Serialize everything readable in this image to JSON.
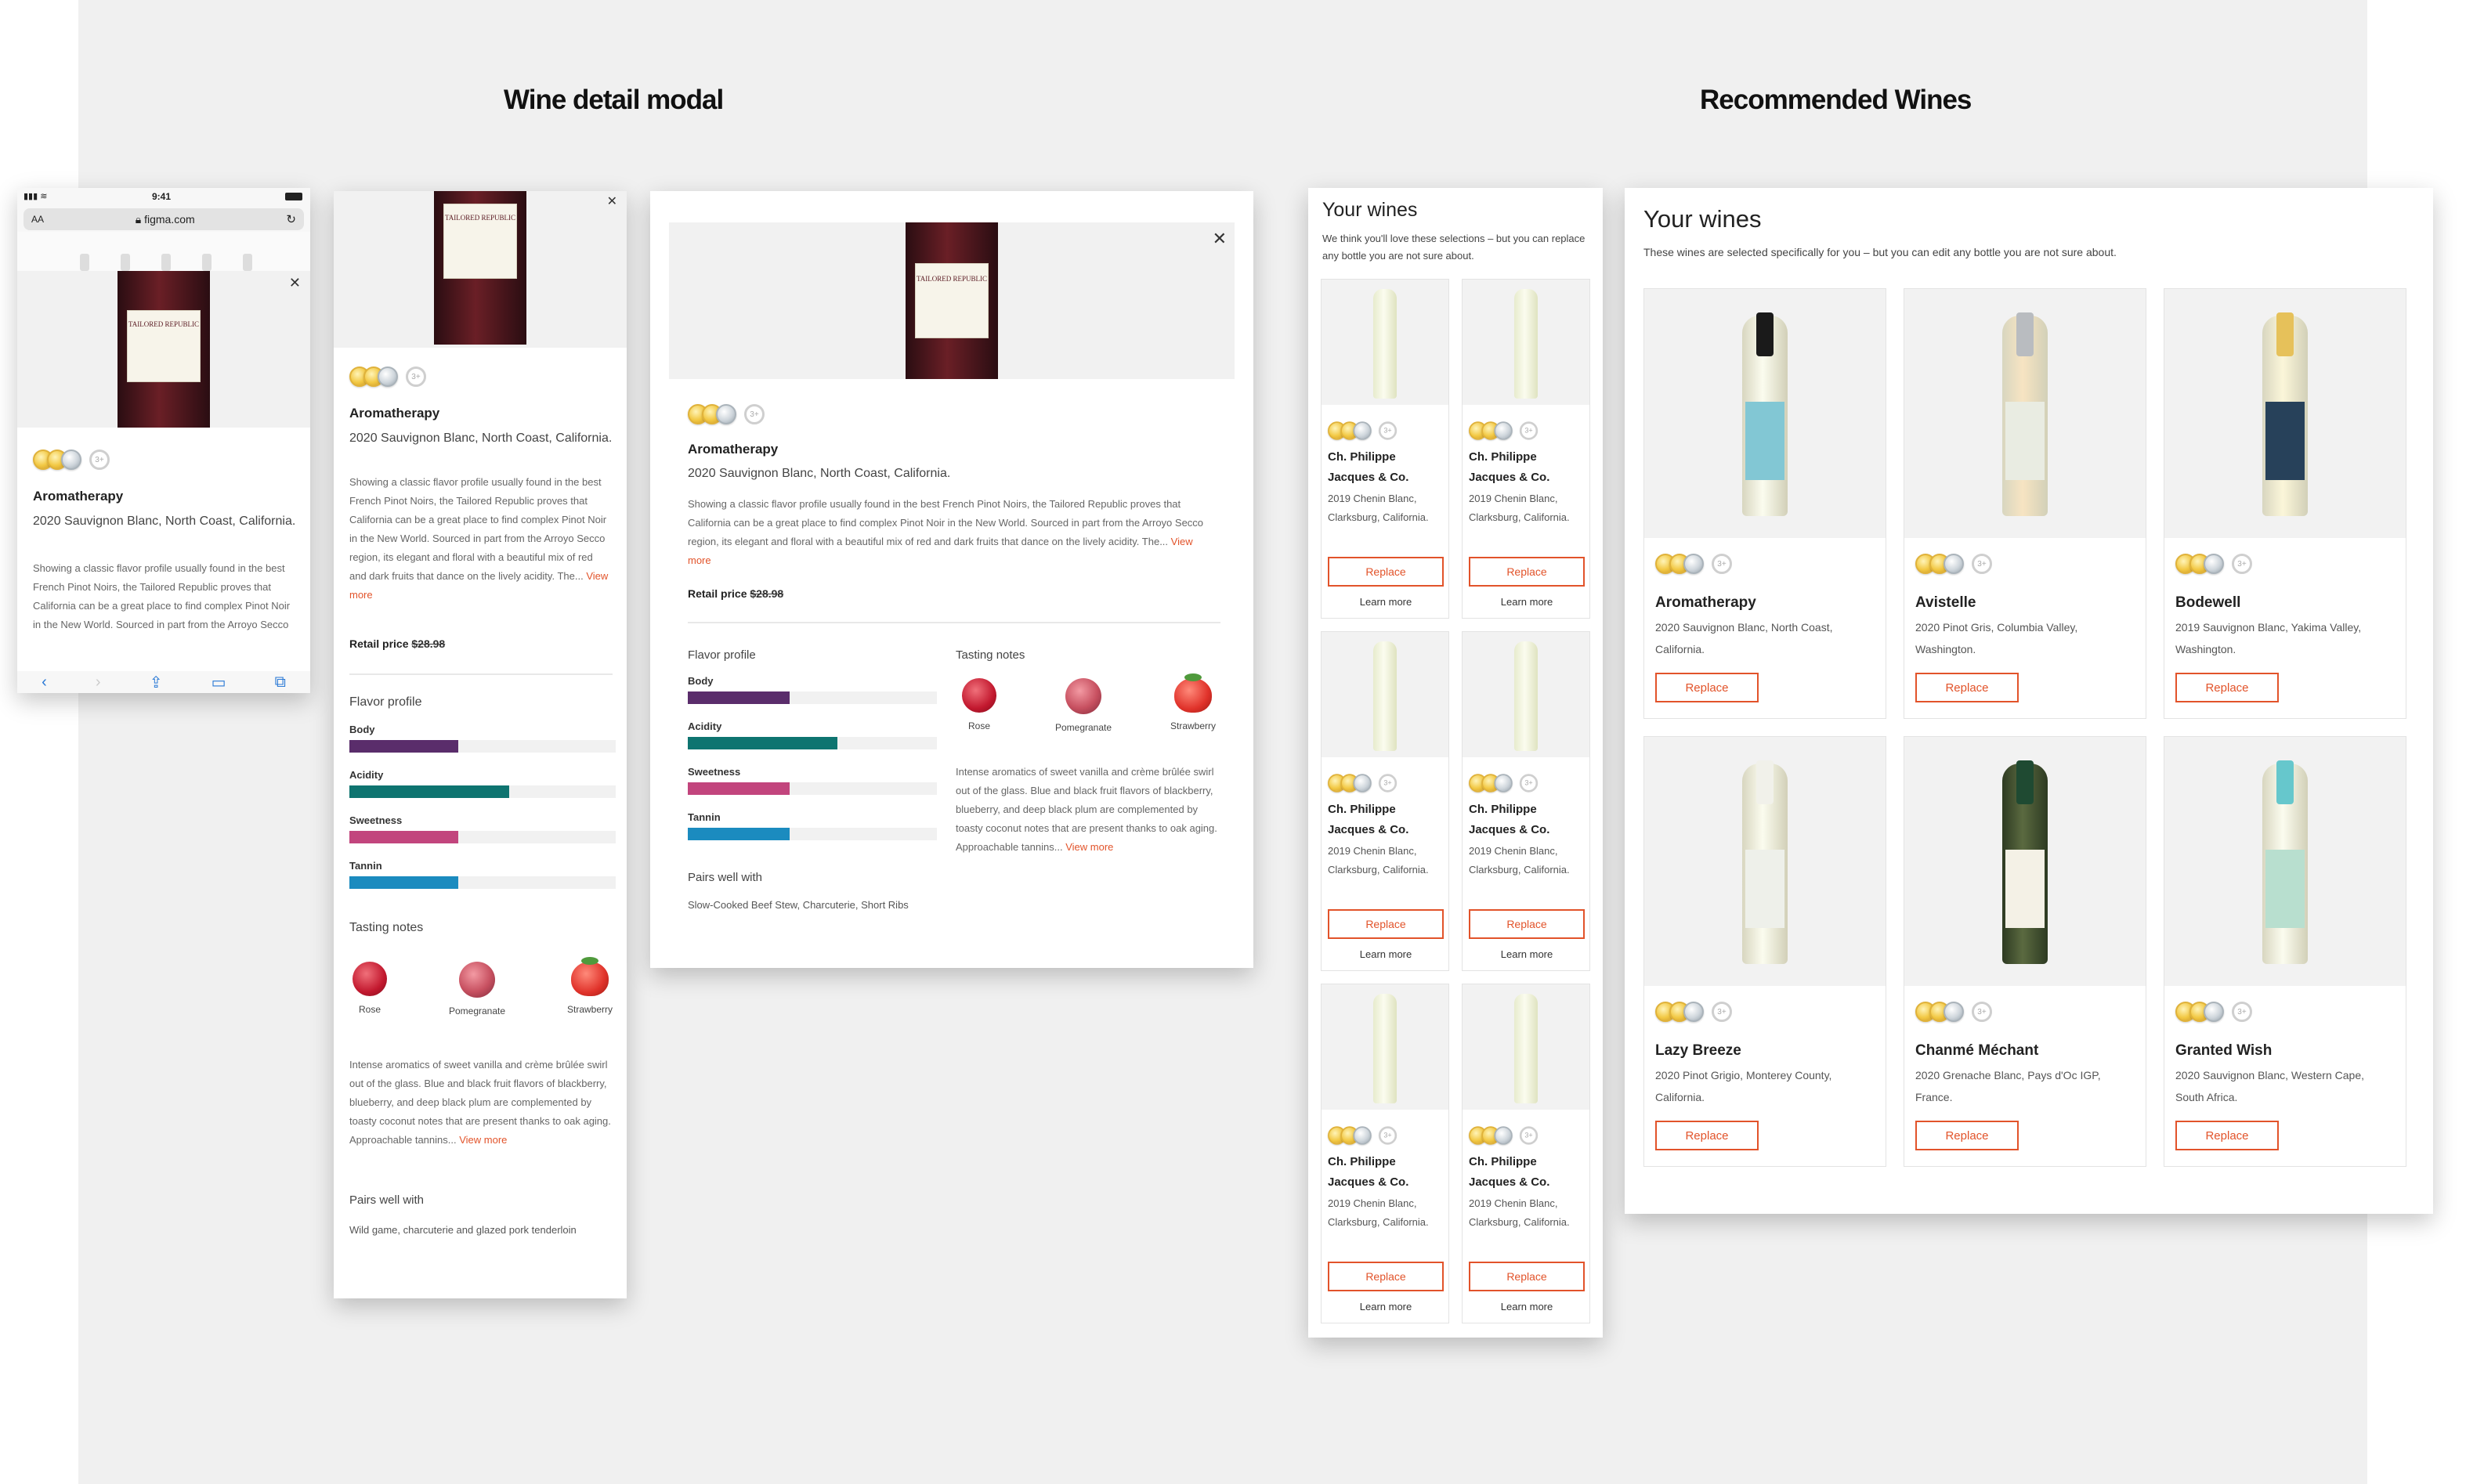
{
  "sections": {
    "left_title": "Wine detail modal",
    "right_title": "Recommended Wines"
  },
  "colors": {
    "accent": "#e2532a",
    "body": "#5a2d6b",
    "acidity": "#0e7470",
    "sweetness": "#c2457d",
    "tannin": "#1b8bbf"
  },
  "phone": {
    "time": "9:41",
    "text_size": "AA",
    "url": "figma.com"
  },
  "wine": {
    "name": "Aromatherapy",
    "varietal": "2020 Sauvignon Blanc, North Coast, California.",
    "description": "Showing a classic flavor profile usually found in the best French Pinot Noirs, the Tailored Republic proves that California can be a great place to find complex Pinot Noir in the New World. Sourced in part from the Arroyo Secco region, its elegant and floral with a beautiful mix of red and dark fruits that dance on the lively acidity. The...",
    "phone_description": "Showing a classic flavor profile usually found in the best French Pinot Noirs, the Tailored Republic proves that California can be a great place to find complex Pinot Noir in the New World. Sourced in part from the Arroyo Secco region, its elegant and floral with a beautiful mix",
    "view_more": "View more",
    "retail_label": "Retail price",
    "retail_price": "$28.98",
    "flavor_title": "Flavor profile",
    "flavors": [
      {
        "label": "Body",
        "value": 0.41
      },
      {
        "label": "Acidity",
        "value": 0.6
      },
      {
        "label": "Sweetness",
        "value": 0.41
      },
      {
        "label": "Tannin",
        "value": 0.41
      }
    ],
    "tasting_title": "Tasting notes",
    "notes": [
      "Rose",
      "Pomegranate",
      "Strawberry"
    ],
    "tasting_text": "Intense aromatics of sweet vanilla and crème brûlée swirl out of the glass. Blue and black fruit flavors of blackberry, blueberry, and deep black plum are complemented by toasty coconut notes that are present thanks to oak aging. Approachable tannins...",
    "pairs_title": "Pairs well with",
    "pairs_mobile": "Wild game, charcuterie and glazed pork tenderloin",
    "pairs_desktop": "Slow-Cooked Beef Stew, Charcuterie, Short Ribs",
    "label_brand": "Tailored Republic",
    "plus_badge": "3+"
  },
  "your_wines_small": {
    "title": "Your wines",
    "subtitle": "We think you'll love these selections – but you can replace any bottle you are not sure about.",
    "items": [
      {
        "name": "Ch. Philippe Jacques & Co.",
        "desc": "2019 Chenin Blanc, Clarksburg, California.",
        "button": "Replace",
        "link": "Learn more"
      },
      {
        "name": "Ch. Philippe Jacques & Co.",
        "desc": "2019 Chenin Blanc, Clarksburg, California.",
        "button": "Replace",
        "link": "Learn more"
      },
      {
        "name": "Ch. Philippe Jacques & Co.",
        "desc": "2019 Chenin Blanc, Clarksburg, California.",
        "button": "Replace",
        "link": "Learn more"
      },
      {
        "name": "Ch. Philippe Jacques & Co.",
        "desc": "2019 Chenin Blanc, Clarksburg, California.",
        "button": "Replace",
        "link": "Learn more"
      },
      {
        "name": "Ch. Philippe Jacques & Co.",
        "desc": "2019 Chenin Blanc, Clarksburg, California.",
        "button": "Replace",
        "link": "Learn more"
      },
      {
        "name": "Ch. Philippe Jacques & Co.",
        "desc": "2019 Chenin Blanc, Clarksburg, California.",
        "button": "Replace",
        "link": "Learn more"
      }
    ]
  },
  "your_wines_large": {
    "title": "Your wines",
    "subtitle": "These wines are selected specifically for you – but you can edit any bottle you are not sure about.",
    "items": [
      {
        "name": "Aromatherapy",
        "desc": "2020 Sauvignon Blanc, North Coast, California.",
        "button": "Replace"
      },
      {
        "name": "Avistelle",
        "desc": "2020 Pinot Gris, Columbia Valley, Washington.",
        "button": "Replace"
      },
      {
        "name": "Bodewell",
        "desc": "2019 Sauvignon Blanc, Yakima Valley, Washington.",
        "button": "Replace"
      },
      {
        "name": "Lazy Breeze",
        "desc": "2020 Pinot Grigio, Monterey County, California.",
        "button": "Replace"
      },
      {
        "name": "Chanmé Méchant",
        "desc": "2020 Grenache Blanc, Pays d'Oc IGP, France.",
        "button": "Replace"
      },
      {
        "name": "Granted Wish",
        "desc": "2020 Sauvignon Blanc, Western Cape, South Africa.",
        "button": "Replace"
      }
    ]
  }
}
